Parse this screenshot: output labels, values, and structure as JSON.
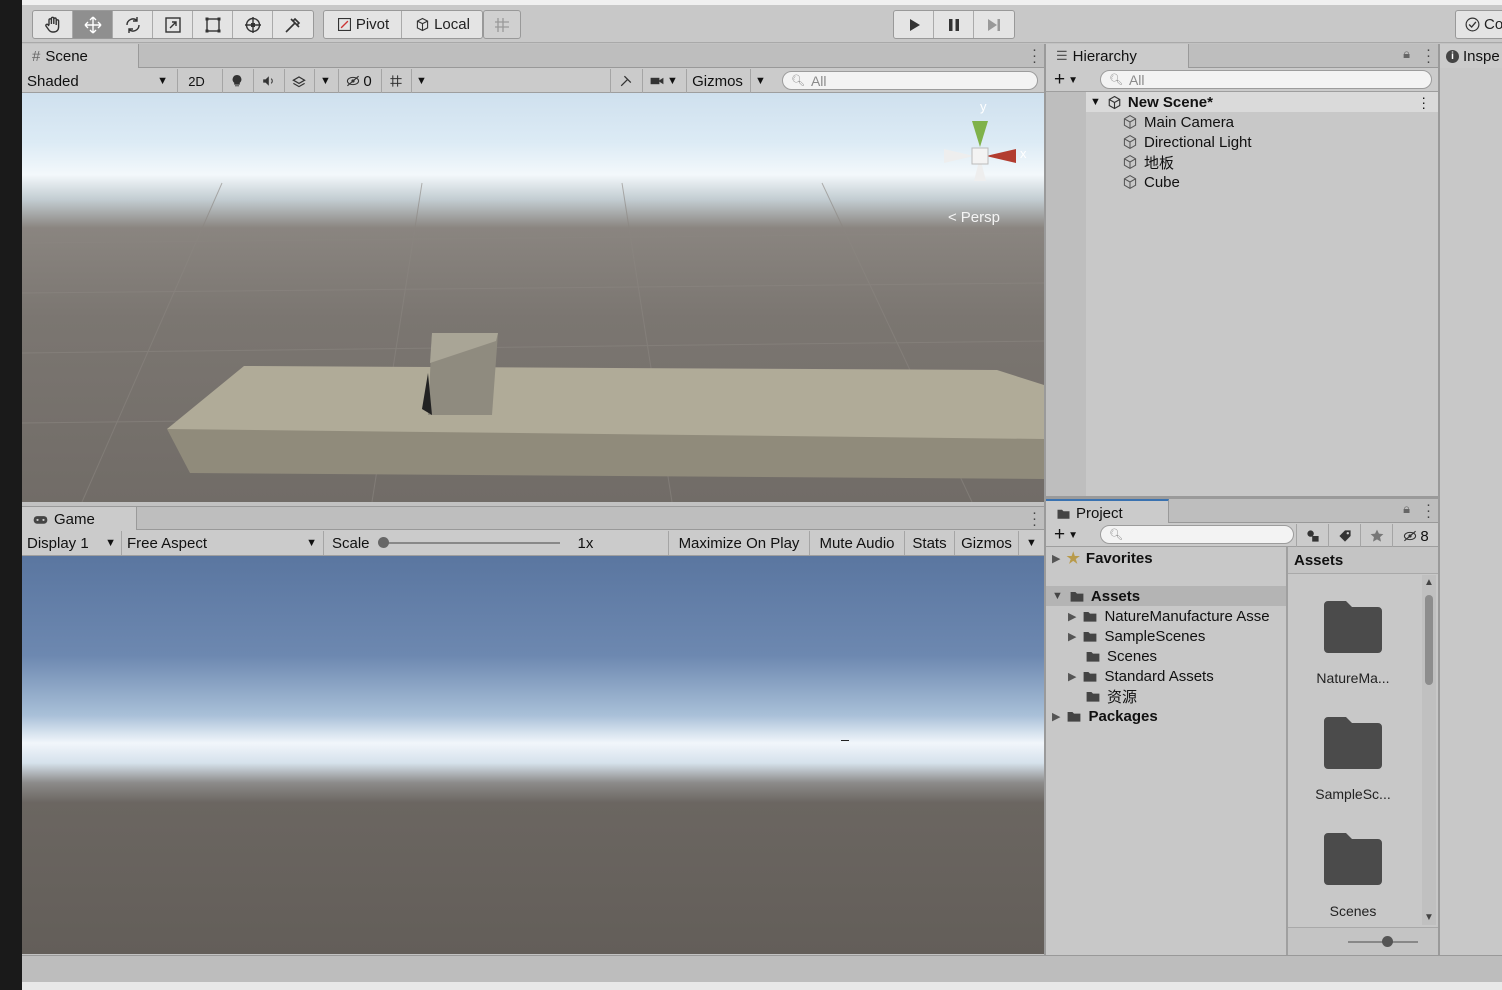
{
  "toolbar": {
    "pivot_label": "Pivot",
    "local_label": "Local",
    "collab_label": "Co",
    "tools": [
      "hand-tool-icon",
      "move-tool-icon",
      "rotate-tool-icon",
      "scale-tool-icon",
      "rect-tool-icon",
      "transform-tool-icon",
      "custom-tool-icon"
    ]
  },
  "scene": {
    "tab_label": "Scene",
    "shading_mode": "Shaded",
    "mode_2d_label": "2D",
    "hidden_count": "0",
    "gizmos_label": "Gizmos",
    "search_placeholder": "All",
    "gizmo_y": "y",
    "gizmo_x": "x",
    "persp_label": "Persp"
  },
  "game": {
    "tab_label": "Game",
    "display": "Display 1",
    "aspect": "Free Aspect",
    "scale_label": "Scale",
    "scale_value": "1x",
    "maximize_label": "Maximize On Play",
    "mute_label": "Mute Audio",
    "stats_label": "Stats",
    "gizmos_label": "Gizmos"
  },
  "hierarchy": {
    "tab_label": "Hierarchy",
    "search_placeholder": "All",
    "scene_name": "New Scene*",
    "items": [
      "Main Camera",
      "Directional Light",
      "地板",
      "Cube"
    ]
  },
  "inspector": {
    "tab_label": "Inspe"
  },
  "project": {
    "tab_label": "Project",
    "hidden_count": "8",
    "tree": {
      "favorites": "Favorites",
      "assets": "Assets",
      "asset_children": [
        "NatureManufacture Asse",
        "SampleScenes",
        "Scenes",
        "Standard Assets",
        "资源"
      ],
      "packages": "Packages"
    },
    "grid_header": "Assets",
    "grid_items": [
      "NatureMa...",
      "SampleSc...",
      "Scenes"
    ]
  }
}
